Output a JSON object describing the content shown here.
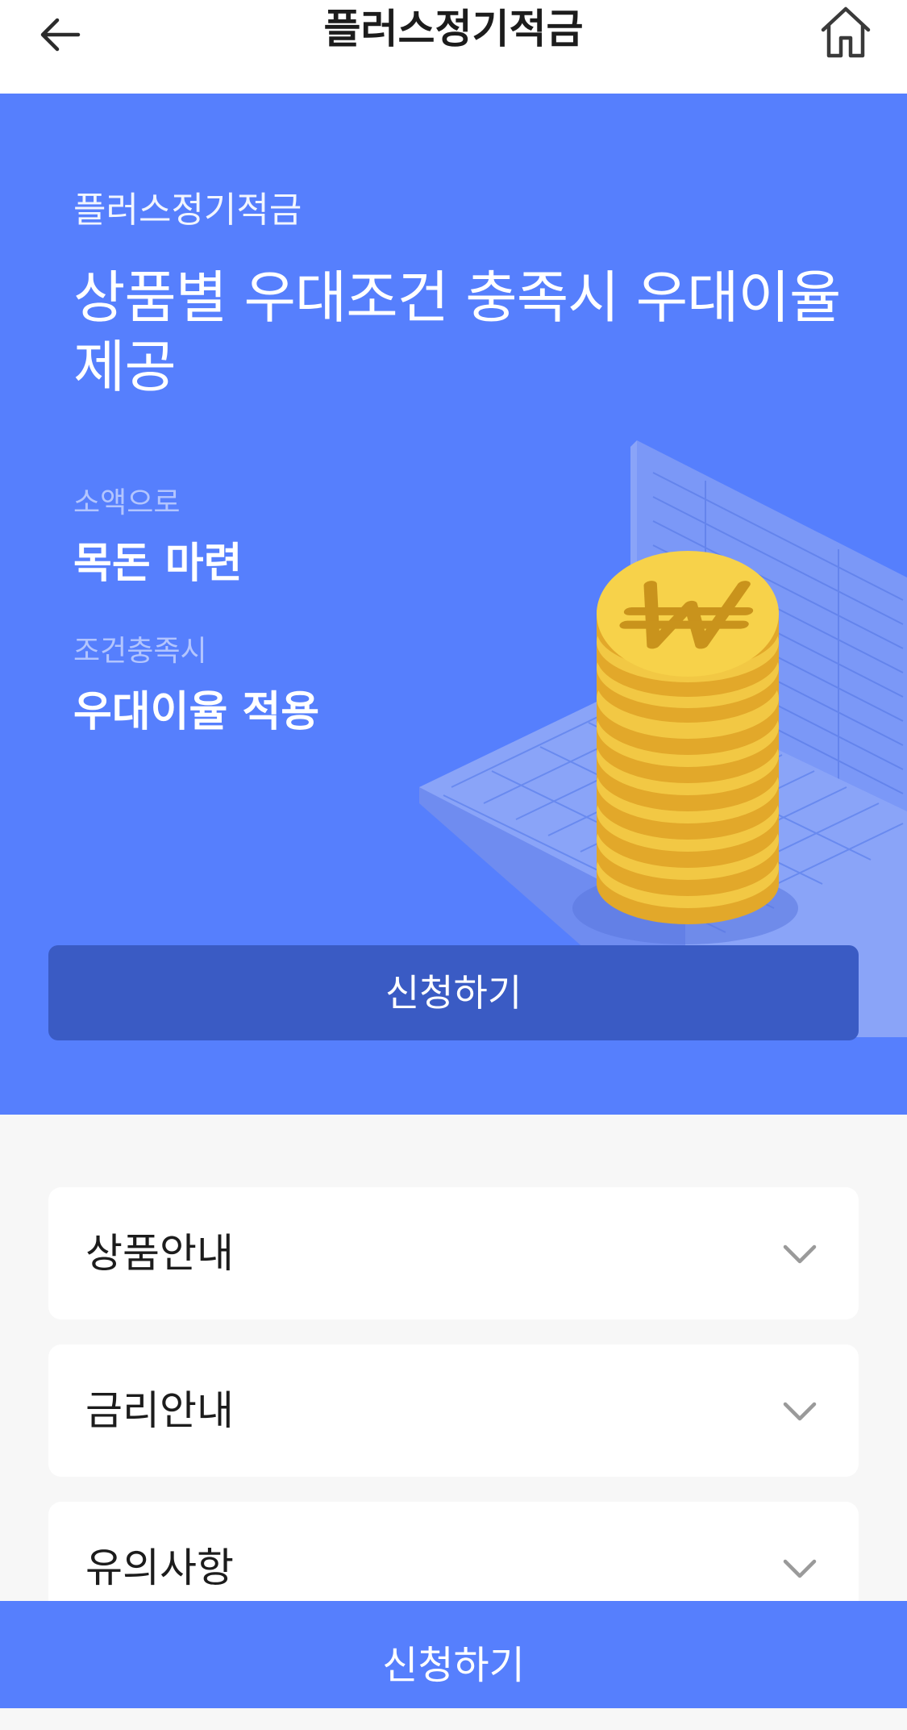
{
  "header": {
    "title": "플러스정기적금",
    "back_icon": "arrow-left-icon",
    "home_icon": "home-icon"
  },
  "hero": {
    "eyebrow": "플러스정기적금",
    "headline": "상품별 우대조건 충족시 우대이율 제공",
    "features": [
      {
        "label": "소액으로",
        "value": "목돈 마련"
      },
      {
        "label": "조건충족시",
        "value": "우대이율 적용"
      }
    ],
    "apply_label": "신청하기",
    "illustration": "coin-stack-illustration",
    "coin_symbol": "₩"
  },
  "accordion": {
    "items": [
      {
        "label": "상품안내",
        "icon": "chevron-down-icon"
      },
      {
        "label": "금리안내",
        "icon": "chevron-down-icon"
      },
      {
        "label": "유의사항",
        "icon": "chevron-down-icon"
      }
    ]
  },
  "bottom_bar": {
    "apply_label": "신청하기"
  },
  "colors": {
    "hero_background": "#567ffd",
    "hero_button": "#3a5bc4",
    "page_background": "#f7f7f7",
    "coin": "#f0c23a"
  }
}
